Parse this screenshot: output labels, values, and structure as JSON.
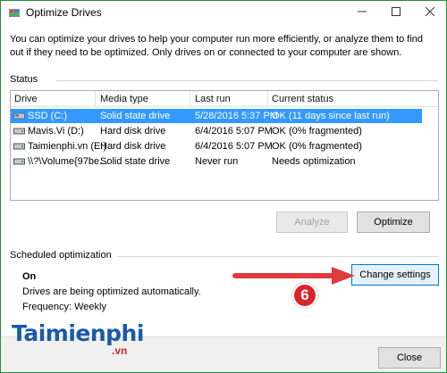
{
  "window": {
    "title": "Optimize Drives"
  },
  "intro": "You can optimize your drives to help your computer run more efficiently, or analyze them to find out if they need to be optimized. Only drives on or connected to your computer are shown.",
  "status": {
    "label": "Status",
    "columns": [
      "Drive",
      "Media type",
      "Last run",
      "Current status"
    ],
    "rows": [
      {
        "drive": "SSD (C:)",
        "media": "Solid state drive",
        "last_run": "5/28/2016 5:37 PM",
        "status": "OK (11 days since last run)",
        "selected": true
      },
      {
        "drive": "Mavis.Vi (D:)",
        "media": "Hard disk drive",
        "last_run": "6/4/2016 5:07 PM",
        "status": "OK (0% fragmented)",
        "selected": false
      },
      {
        "drive": "Taimienphi.vn (E:)",
        "media": "Hard disk drive",
        "last_run": "6/4/2016 5:07 PM",
        "status": "OK (0% fragmented)",
        "selected": false
      },
      {
        "drive": "\\\\?\\Volume{97be...",
        "media": "Solid state drive",
        "last_run": "Never run",
        "status": "Needs optimization",
        "selected": false
      }
    ],
    "analyze_label": "Analyze",
    "optimize_label": "Optimize"
  },
  "scheduled": {
    "label": "Scheduled optimization",
    "state": "On",
    "description": "Drives are being optimized automatically.",
    "frequency": "Frequency: Weekly",
    "change_label": "Change settings"
  },
  "footer": {
    "close_label": "Close"
  },
  "annotation": {
    "step": "6",
    "arrow_color": "#e03a3e"
  },
  "watermark": {
    "logo": "Taimienphi",
    "suffix": ".vn"
  },
  "colors": {
    "selection": "#3399ff",
    "accent": "#0078d7",
    "window_border": "#2b8a3e"
  }
}
